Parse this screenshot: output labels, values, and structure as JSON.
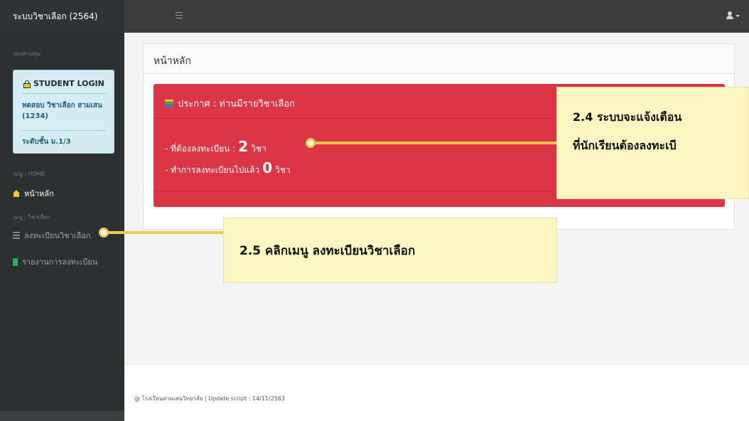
{
  "navbar": {
    "brand": "ระบบวิชาเลือก (2564)",
    "menu_icon": "hamburger-icon",
    "user_icon": "user-icon"
  },
  "sidebar": {
    "section_panel": "แผงควบคุม",
    "student_box": {
      "title": "STUDENT LOGIN",
      "name": "ทดสอบ วิชาเลือก สามเสน (1234)",
      "class": "ระดับชั้น ม.1/3"
    },
    "section_home": "เมนู : HOME",
    "home_item": "หน้าหลัก",
    "section_elective": "เมนู : วิชาเลือก",
    "items": [
      {
        "label": "ลงทะเบียนวิชาเลือก",
        "icon": "list-icon"
      },
      {
        "label": "รายงานการลงทะเบียน",
        "icon": "book-icon"
      }
    ]
  },
  "main": {
    "page_title": "หน้าหลัก",
    "alert": {
      "heading": "ประกาศ : ท่านมีรายวิชาเลือก",
      "required_prefix": "- ที่ต้องลงทะเบียน :",
      "required_count": "2",
      "registered_prefix": "- ทำการลงทะเบียนไปแล้ว",
      "registered_count": "0",
      "unit": "วิชา",
      "color": "#dc3545"
    }
  },
  "callouts": {
    "notice_line1": "2.4 ระบบจะแจ้งเตือน",
    "notice_line2": "ที่นักเรียนต้องลงทะเบี",
    "menu_hint": "2.5 คลิกเมนู ลงทะเบียนวิชาเลือก",
    "color": "#f2c94c"
  },
  "footer": {
    "text": "@ โรงเรียนสามเสนวิทยาลัย | Update script : 14/11/2563"
  }
}
